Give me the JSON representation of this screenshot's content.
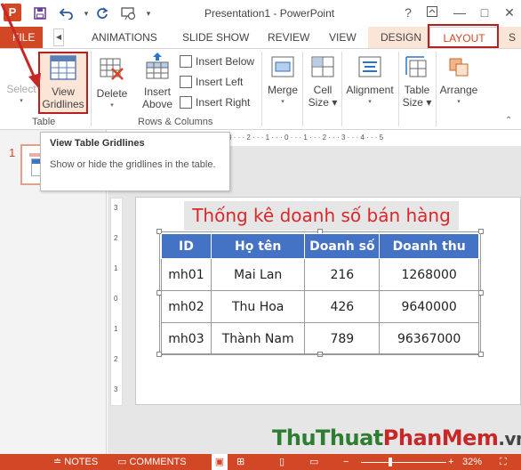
{
  "window": {
    "title": "Presentation1 - PowerPoint",
    "app_badge": "P"
  },
  "qat": {
    "save_icon": "save-icon",
    "undo_icon": "undo-icon",
    "redo_icon": "redo-icon",
    "present_icon": "start-slideshow-icon"
  },
  "controls": {
    "help": "?",
    "restore": "▢",
    "minimize": "—",
    "maximize": "□",
    "close": "✕"
  },
  "tabs": {
    "file": "FILE",
    "animations": "ANIMATIONS",
    "slide_show": "SLIDE SHOW",
    "review": "REVIEW",
    "view": "VIEW",
    "design": "DESIGN",
    "layout": "LAYOUT",
    "overflow": "S"
  },
  "ribbon": {
    "select": "Select",
    "view_gridlines_line1": "View",
    "view_gridlines_line2": "Gridlines",
    "delete": "Delete",
    "insert_above_line1": "Insert",
    "insert_above_line2": "Above",
    "insert_below": "Insert Below",
    "insert_left": "Insert Left",
    "insert_right": "Insert Right",
    "merge": "Merge",
    "cell_size_line1": "Cell",
    "cell_size_line2": "Size",
    "alignment": "Alignment",
    "table_size_line1": "Table",
    "table_size_line2": "Size",
    "arrange": "Arrange",
    "group_table": "Table",
    "group_rows_columns": "Rows & Columns"
  },
  "tooltip": {
    "title": "View Table Gridlines",
    "description": "Show or hide the gridlines in the table."
  },
  "slides_pane": {
    "slide_number": "1"
  },
  "ruler": {
    "horizontal": "3 · · · 2 · · · 1 · · · 0 · · · 1 · · · 2 · · · 3 · · · 4 · · · 5",
    "vertical": [
      "3",
      "2",
      "1",
      "0",
      "1",
      "2",
      "3"
    ]
  },
  "slide": {
    "title": "Thống kê doanh số bán hàng",
    "table": {
      "headers": [
        "ID",
        "Họ tên",
        "Doanh số",
        "Doanh thu"
      ],
      "rows": [
        [
          "mh01",
          "Mai Lan",
          "216",
          "1268000"
        ],
        [
          "mh02",
          "Thu Hoa",
          "426",
          "9640000"
        ],
        [
          "mh03",
          "Thành Nam",
          "789",
          "96367000"
        ]
      ]
    }
  },
  "watermark": {
    "part1": "ThuThuat",
    "part2": "PhanMem",
    "part3": ".vn"
  },
  "status": {
    "notes": "NOTES",
    "comments": "COMMENTS",
    "zoom": "32%",
    "zoom_percent": 32
  },
  "colors": {
    "accent": "#d24726",
    "table_header": "#4472c4",
    "title_text": "#d8282a",
    "highlight_box": "#b52121"
  }
}
